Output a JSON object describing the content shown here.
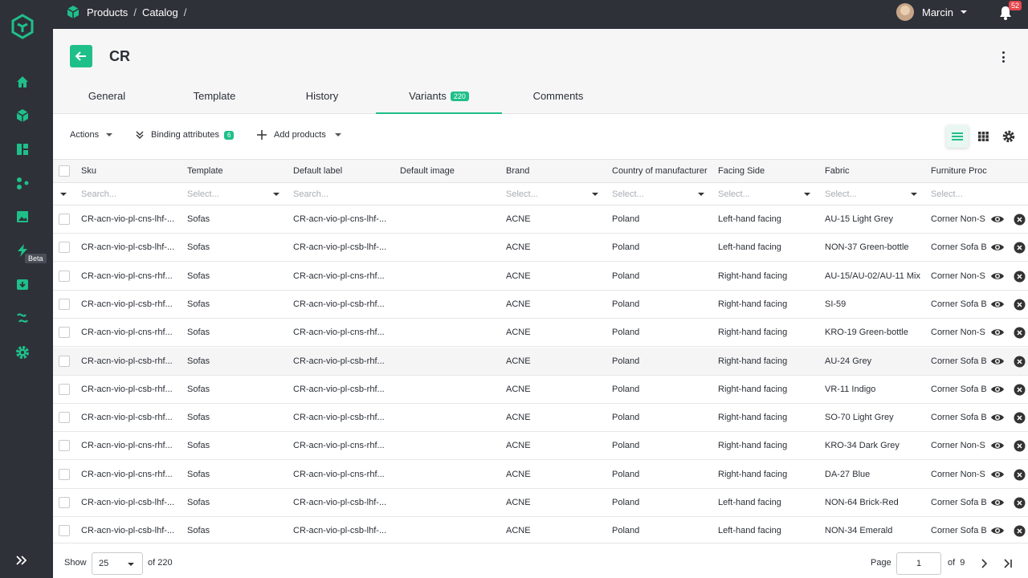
{
  "breadcrumb": {
    "items": [
      "Products",
      "Catalog"
    ],
    "separator": "/"
  },
  "user": {
    "name": "Marcin"
  },
  "notifications": {
    "count": "52"
  },
  "sidebar": {
    "beta_label": "Beta"
  },
  "page": {
    "title": "CR"
  },
  "tabs": [
    {
      "label": "General"
    },
    {
      "label": "Template"
    },
    {
      "label": "History"
    },
    {
      "label": "Variants",
      "count": "220",
      "active": true
    },
    {
      "label": "Comments"
    }
  ],
  "toolbar": {
    "actions_label": "Actions",
    "binding_label": "Binding attributes",
    "binding_count": "6",
    "add_label": "Add products"
  },
  "columns": [
    "Sku",
    "Template",
    "Default label",
    "Default image",
    "Brand",
    "Country of manufacturer",
    "Facing Side",
    "Fabric",
    "Furniture Proc"
  ],
  "filters": {
    "search": "Search...",
    "select": "Select..."
  },
  "rows": [
    {
      "sku": "CR-acn-vio-pl-cns-lhf-...",
      "template": "Sofas",
      "label": "CR-acn-vio-pl-cns-lhf-...",
      "brand": "ACNE",
      "country": "Poland",
      "side": "Left-hand facing",
      "fabric": "AU-15 Light Grey",
      "furniture": "Corner Non-S"
    },
    {
      "sku": "CR-acn-vio-pl-csb-lhf-...",
      "template": "Sofas",
      "label": "CR-acn-vio-pl-csb-lhf-...",
      "brand": "ACNE",
      "country": "Poland",
      "side": "Left-hand facing",
      "fabric": "NON-37 Green-bottle",
      "furniture": "Corner Sofa B"
    },
    {
      "sku": "CR-acn-vio-pl-cns-rhf...",
      "template": "Sofas",
      "label": "CR-acn-vio-pl-cns-rhf...",
      "brand": "ACNE",
      "country": "Poland",
      "side": "Right-hand facing",
      "fabric": "AU-15/AU-02/AU-11 Mix",
      "furniture": "Corner Non-S"
    },
    {
      "sku": "CR-acn-vio-pl-csb-rhf...",
      "template": "Sofas",
      "label": "CR-acn-vio-pl-csb-rhf...",
      "brand": "ACNE",
      "country": "Poland",
      "side": "Right-hand facing",
      "fabric": "SI-59",
      "furniture": "Corner Sofa B"
    },
    {
      "sku": "CR-acn-vio-pl-cns-rhf...",
      "template": "Sofas",
      "label": "CR-acn-vio-pl-cns-rhf...",
      "brand": "ACNE",
      "country": "Poland",
      "side": "Right-hand facing",
      "fabric": "KRO-19 Green-bottle",
      "furniture": "Corner Non-S"
    },
    {
      "sku": "CR-acn-vio-pl-csb-rhf...",
      "template": "Sofas",
      "label": "CR-acn-vio-pl-csb-rhf...",
      "brand": "ACNE",
      "country": "Poland",
      "side": "Right-hand facing",
      "fabric": "AU-24 Grey",
      "furniture": "Corner Sofa B",
      "highlight": true
    },
    {
      "sku": "CR-acn-vio-pl-csb-rhf...",
      "template": "Sofas",
      "label": "CR-acn-vio-pl-csb-rhf...",
      "brand": "ACNE",
      "country": "Poland",
      "side": "Right-hand facing",
      "fabric": "VR-11 Indigo",
      "furniture": "Corner Sofa B"
    },
    {
      "sku": "CR-acn-vio-pl-csb-rhf...",
      "template": "Sofas",
      "label": "CR-acn-vio-pl-csb-rhf...",
      "brand": "ACNE",
      "country": "Poland",
      "side": "Right-hand facing",
      "fabric": "SO-70 Light Grey",
      "furniture": "Corner Sofa B"
    },
    {
      "sku": "CR-acn-vio-pl-cns-rhf...",
      "template": "Sofas",
      "label": "CR-acn-vio-pl-cns-rhf...",
      "brand": "ACNE",
      "country": "Poland",
      "side": "Right-hand facing",
      "fabric": "KRO-34 Dark Grey",
      "furniture": "Corner Non-S"
    },
    {
      "sku": "CR-acn-vio-pl-cns-rhf...",
      "template": "Sofas",
      "label": "CR-acn-vio-pl-cns-rhf...",
      "brand": "ACNE",
      "country": "Poland",
      "side": "Right-hand facing",
      "fabric": "DA-27 Blue",
      "furniture": "Corner Non-S"
    },
    {
      "sku": "CR-acn-vio-pl-csb-lhf-...",
      "template": "Sofas",
      "label": "CR-acn-vio-pl-csb-lhf-...",
      "brand": "ACNE",
      "country": "Poland",
      "side": "Left-hand facing",
      "fabric": "NON-64 Brick-Red",
      "furniture": "Corner Sofa B"
    },
    {
      "sku": "CR-acn-vio-pl-csb-lhf-...",
      "template": "Sofas",
      "label": "CR-acn-vio-pl-csb-lhf-...",
      "brand": "ACNE",
      "country": "Poland",
      "side": "Left-hand facing",
      "fabric": "NON-34 Emerald",
      "furniture": "Corner Sofa B"
    }
  ],
  "pagination": {
    "show_label": "Show",
    "page_size": "25",
    "of_total": "of 220",
    "page_label": "Page",
    "current_page": "1",
    "of_pages": "of  9"
  },
  "colors": {
    "accent": "#1fbf8a",
    "sidebar": "#2e3138",
    "danger": "#e5484d"
  },
  "icons": [
    "logo-icon",
    "home-icon",
    "cube-icon",
    "dashboard-icon",
    "workflow-icon",
    "image-icon",
    "lightning-icon",
    "import-icon",
    "integration-icon",
    "gear-icon",
    "expand-icon",
    "bell-icon",
    "back-arrow-icon",
    "kebab-icon",
    "list-view-icon",
    "grid-view-icon",
    "settings-icon",
    "eye-icon",
    "remove-icon",
    "next-page-icon",
    "last-page-icon"
  ]
}
